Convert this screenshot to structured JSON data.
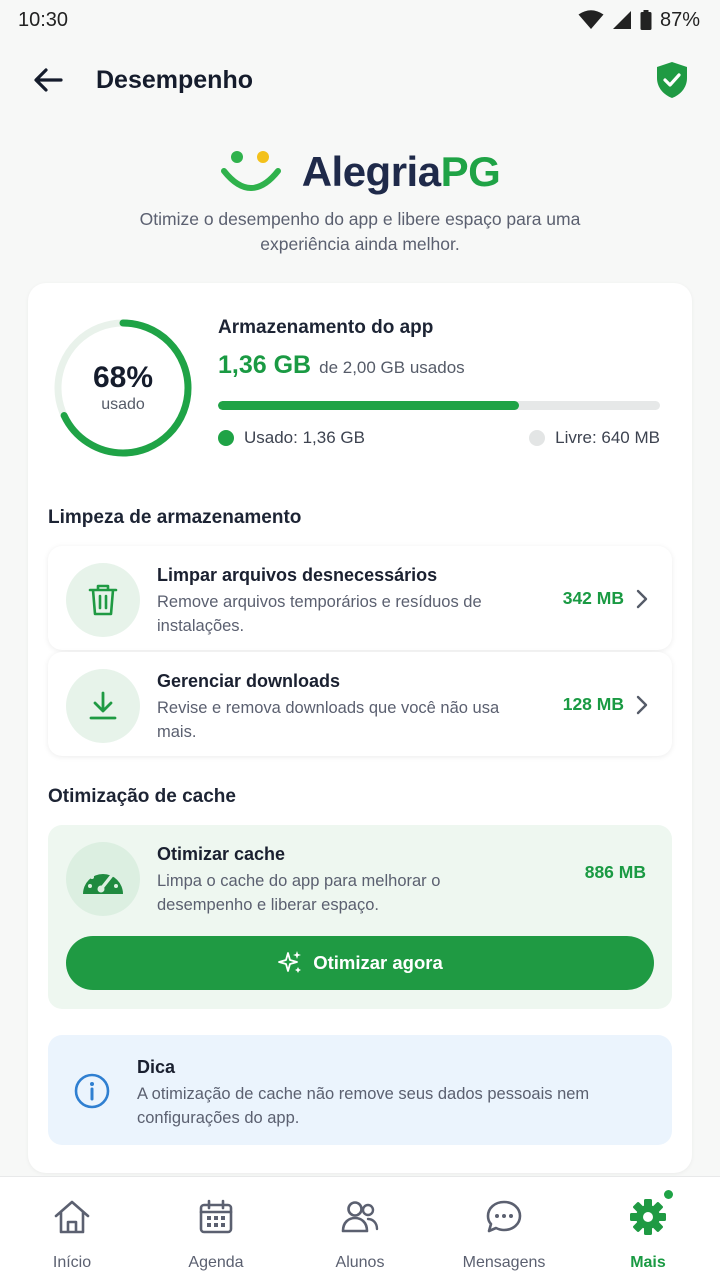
{
  "status_bar": {
    "time": "10:30",
    "battery": "87%"
  },
  "header": {
    "title": "Desempenho"
  },
  "brand": {
    "name_part1": "Alegria",
    "name_part2": "PG"
  },
  "subtitle": "Otimize o desempenho do app e libere espaço para uma experiência ainda melhor.",
  "storage": {
    "title": "Armazenamento do app",
    "percent_label": "68%",
    "percent_value": 0.68,
    "used_caption": "usado",
    "used_value": "1,36 GB",
    "of_total": "de 2,00 GB usados",
    "legend_used": "Usado: 1,36 GB",
    "legend_free": "Livre: 640 MB"
  },
  "cleanup": {
    "section_title": "Limpeza de armazenamento",
    "items": [
      {
        "title": "Limpar arquivos desnecessários",
        "description": "Remove arquivos temporários e resíduos de instalações.",
        "size": "342 MB",
        "icon": "trash-icon"
      },
      {
        "title": "Gerenciar downloads",
        "description": "Revise e remova downloads que você não usa mais.",
        "size": "128 MB",
        "icon": "download-icon"
      }
    ]
  },
  "cache": {
    "section_title": "Otimização de cache",
    "title": "Otimizar cache",
    "description": "Limpa o cache do app para melhorar o desempenho e liberar espaço.",
    "size": "886 MB",
    "button_label": "Otimizar agora"
  },
  "tip": {
    "title": "Dica",
    "text": "A otimização de cache não remove seus dados pessoais nem configurações do app."
  },
  "nav": {
    "items": [
      {
        "label": "Início",
        "icon": "home-icon"
      },
      {
        "label": "Agenda",
        "icon": "calendar-icon"
      },
      {
        "label": "Alunos",
        "icon": "users-icon"
      },
      {
        "label": "Mensagens",
        "icon": "chat-icon"
      },
      {
        "label": "Mais",
        "icon": "gear-icon",
        "active": true
      }
    ]
  },
  "colors": {
    "accent": "#1fa346",
    "brand_dark": "#1f2a4a",
    "tip_bg": "#ebf4fd",
    "info_blue": "#2f7fd1"
  }
}
